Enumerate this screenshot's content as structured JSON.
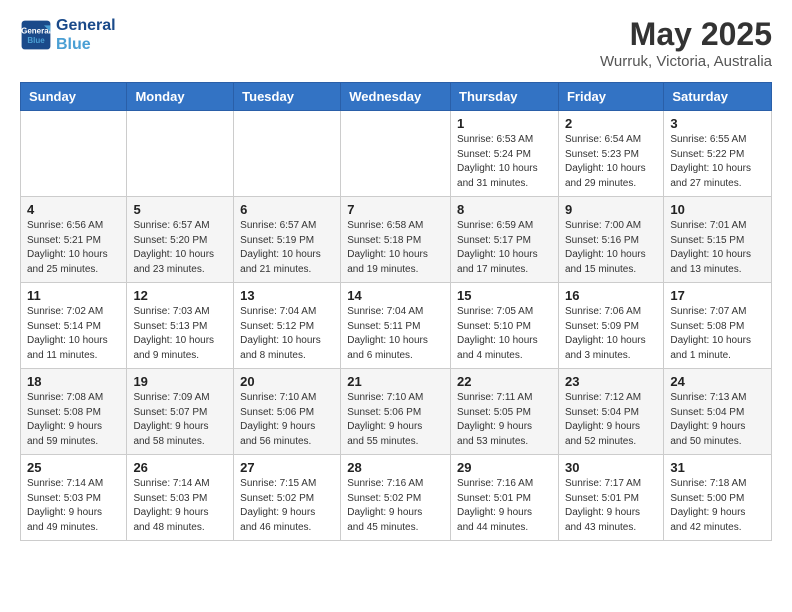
{
  "logo": {
    "line1": "General",
    "line2": "Blue"
  },
  "title": "May 2025",
  "subtitle": "Wurruk, Victoria, Australia",
  "days_of_week": [
    "Sunday",
    "Monday",
    "Tuesday",
    "Wednesday",
    "Thursday",
    "Friday",
    "Saturday"
  ],
  "weeks": [
    [
      {
        "day": "",
        "info": ""
      },
      {
        "day": "",
        "info": ""
      },
      {
        "day": "",
        "info": ""
      },
      {
        "day": "",
        "info": ""
      },
      {
        "day": "1",
        "info": "Sunrise: 6:53 AM\nSunset: 5:24 PM\nDaylight: 10 hours\nand 31 minutes."
      },
      {
        "day": "2",
        "info": "Sunrise: 6:54 AM\nSunset: 5:23 PM\nDaylight: 10 hours\nand 29 minutes."
      },
      {
        "day": "3",
        "info": "Sunrise: 6:55 AM\nSunset: 5:22 PM\nDaylight: 10 hours\nand 27 minutes."
      }
    ],
    [
      {
        "day": "4",
        "info": "Sunrise: 6:56 AM\nSunset: 5:21 PM\nDaylight: 10 hours\nand 25 minutes."
      },
      {
        "day": "5",
        "info": "Sunrise: 6:57 AM\nSunset: 5:20 PM\nDaylight: 10 hours\nand 23 minutes."
      },
      {
        "day": "6",
        "info": "Sunrise: 6:57 AM\nSunset: 5:19 PM\nDaylight: 10 hours\nand 21 minutes."
      },
      {
        "day": "7",
        "info": "Sunrise: 6:58 AM\nSunset: 5:18 PM\nDaylight: 10 hours\nand 19 minutes."
      },
      {
        "day": "8",
        "info": "Sunrise: 6:59 AM\nSunset: 5:17 PM\nDaylight: 10 hours\nand 17 minutes."
      },
      {
        "day": "9",
        "info": "Sunrise: 7:00 AM\nSunset: 5:16 PM\nDaylight: 10 hours\nand 15 minutes."
      },
      {
        "day": "10",
        "info": "Sunrise: 7:01 AM\nSunset: 5:15 PM\nDaylight: 10 hours\nand 13 minutes."
      }
    ],
    [
      {
        "day": "11",
        "info": "Sunrise: 7:02 AM\nSunset: 5:14 PM\nDaylight: 10 hours\nand 11 minutes."
      },
      {
        "day": "12",
        "info": "Sunrise: 7:03 AM\nSunset: 5:13 PM\nDaylight: 10 hours\nand 9 minutes."
      },
      {
        "day": "13",
        "info": "Sunrise: 7:04 AM\nSunset: 5:12 PM\nDaylight: 10 hours\nand 8 minutes."
      },
      {
        "day": "14",
        "info": "Sunrise: 7:04 AM\nSunset: 5:11 PM\nDaylight: 10 hours\nand 6 minutes."
      },
      {
        "day": "15",
        "info": "Sunrise: 7:05 AM\nSunset: 5:10 PM\nDaylight: 10 hours\nand 4 minutes."
      },
      {
        "day": "16",
        "info": "Sunrise: 7:06 AM\nSunset: 5:09 PM\nDaylight: 10 hours\nand 3 minutes."
      },
      {
        "day": "17",
        "info": "Sunrise: 7:07 AM\nSunset: 5:08 PM\nDaylight: 10 hours\nand 1 minute."
      }
    ],
    [
      {
        "day": "18",
        "info": "Sunrise: 7:08 AM\nSunset: 5:08 PM\nDaylight: 9 hours\nand 59 minutes."
      },
      {
        "day": "19",
        "info": "Sunrise: 7:09 AM\nSunset: 5:07 PM\nDaylight: 9 hours\nand 58 minutes."
      },
      {
        "day": "20",
        "info": "Sunrise: 7:10 AM\nSunset: 5:06 PM\nDaylight: 9 hours\nand 56 minutes."
      },
      {
        "day": "21",
        "info": "Sunrise: 7:10 AM\nSunset: 5:06 PM\nDaylight: 9 hours\nand 55 minutes."
      },
      {
        "day": "22",
        "info": "Sunrise: 7:11 AM\nSunset: 5:05 PM\nDaylight: 9 hours\nand 53 minutes."
      },
      {
        "day": "23",
        "info": "Sunrise: 7:12 AM\nSunset: 5:04 PM\nDaylight: 9 hours\nand 52 minutes."
      },
      {
        "day": "24",
        "info": "Sunrise: 7:13 AM\nSunset: 5:04 PM\nDaylight: 9 hours\nand 50 minutes."
      }
    ],
    [
      {
        "day": "25",
        "info": "Sunrise: 7:14 AM\nSunset: 5:03 PM\nDaylight: 9 hours\nand 49 minutes."
      },
      {
        "day": "26",
        "info": "Sunrise: 7:14 AM\nSunset: 5:03 PM\nDaylight: 9 hours\nand 48 minutes."
      },
      {
        "day": "27",
        "info": "Sunrise: 7:15 AM\nSunset: 5:02 PM\nDaylight: 9 hours\nand 46 minutes."
      },
      {
        "day": "28",
        "info": "Sunrise: 7:16 AM\nSunset: 5:02 PM\nDaylight: 9 hours\nand 45 minutes."
      },
      {
        "day": "29",
        "info": "Sunrise: 7:16 AM\nSunset: 5:01 PM\nDaylight: 9 hours\nand 44 minutes."
      },
      {
        "day": "30",
        "info": "Sunrise: 7:17 AM\nSunset: 5:01 PM\nDaylight: 9 hours\nand 43 minutes."
      },
      {
        "day": "31",
        "info": "Sunrise: 7:18 AM\nSunset: 5:00 PM\nDaylight: 9 hours\nand 42 minutes."
      }
    ]
  ]
}
